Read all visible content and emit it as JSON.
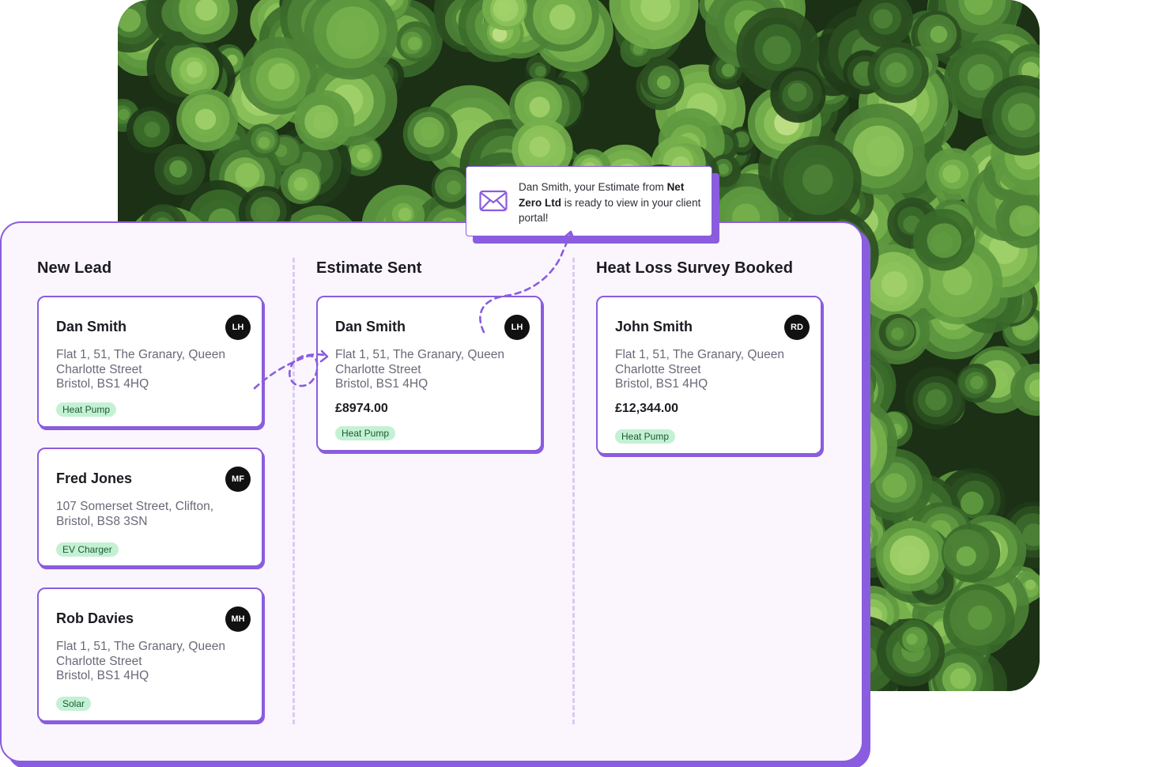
{
  "notification": {
    "text_1": "Dan Smith, your Estimate from ",
    "company": "Net Zero Ltd",
    "text_2": " is ready to view in your client portal!",
    "icon": "mail-icon"
  },
  "columns": [
    {
      "title": "New Lead",
      "cards": [
        {
          "name": "Dan Smith",
          "initials": "LH",
          "address": [
            "Flat 1, 51, The Granary, Queen",
            "Charlotte Street",
            "Bristol, BS1 4HQ"
          ],
          "tag": "Heat Pump"
        },
        {
          "name": "Fred Jones",
          "initials": "MF",
          "address": [
            "107 Somerset Street, Clifton,",
            "Bristol, BS8 3SN"
          ],
          "tag": "EV Charger"
        },
        {
          "name": "Rob Davies",
          "initials": "MH",
          "address": [
            "Flat 1, 51, The Granary, Queen",
            "Charlotte Street",
            "Bristol, BS1 4HQ"
          ],
          "tag": "Solar"
        }
      ]
    },
    {
      "title": "Estimate Sent",
      "cards": [
        {
          "name": "Dan Smith",
          "initials": "LH",
          "address": [
            "Flat 1, 51, The Granary, Queen",
            "Charlotte Street",
            "Bristol, BS1 4HQ"
          ],
          "price": "£8974.00",
          "tag": "Heat Pump"
        }
      ]
    },
    {
      "title": "Heat Loss Survey Booked",
      "cards": [
        {
          "name": "John Smith",
          "initials": "RD",
          "address": [
            "Flat 1, 51, The Granary, Queen",
            "Charlotte Street",
            "Bristol, BS1 4HQ"
          ],
          "price": "£12,344.00",
          "tag": "Heat Pump"
        }
      ]
    }
  ],
  "colors": {
    "accent": "#8a5cdf",
    "board_bg": "#fbf6fd",
    "tag_bg": "#c4f1d3",
    "tag_text": "#1a5a33",
    "avatar_bg": "#111111"
  }
}
